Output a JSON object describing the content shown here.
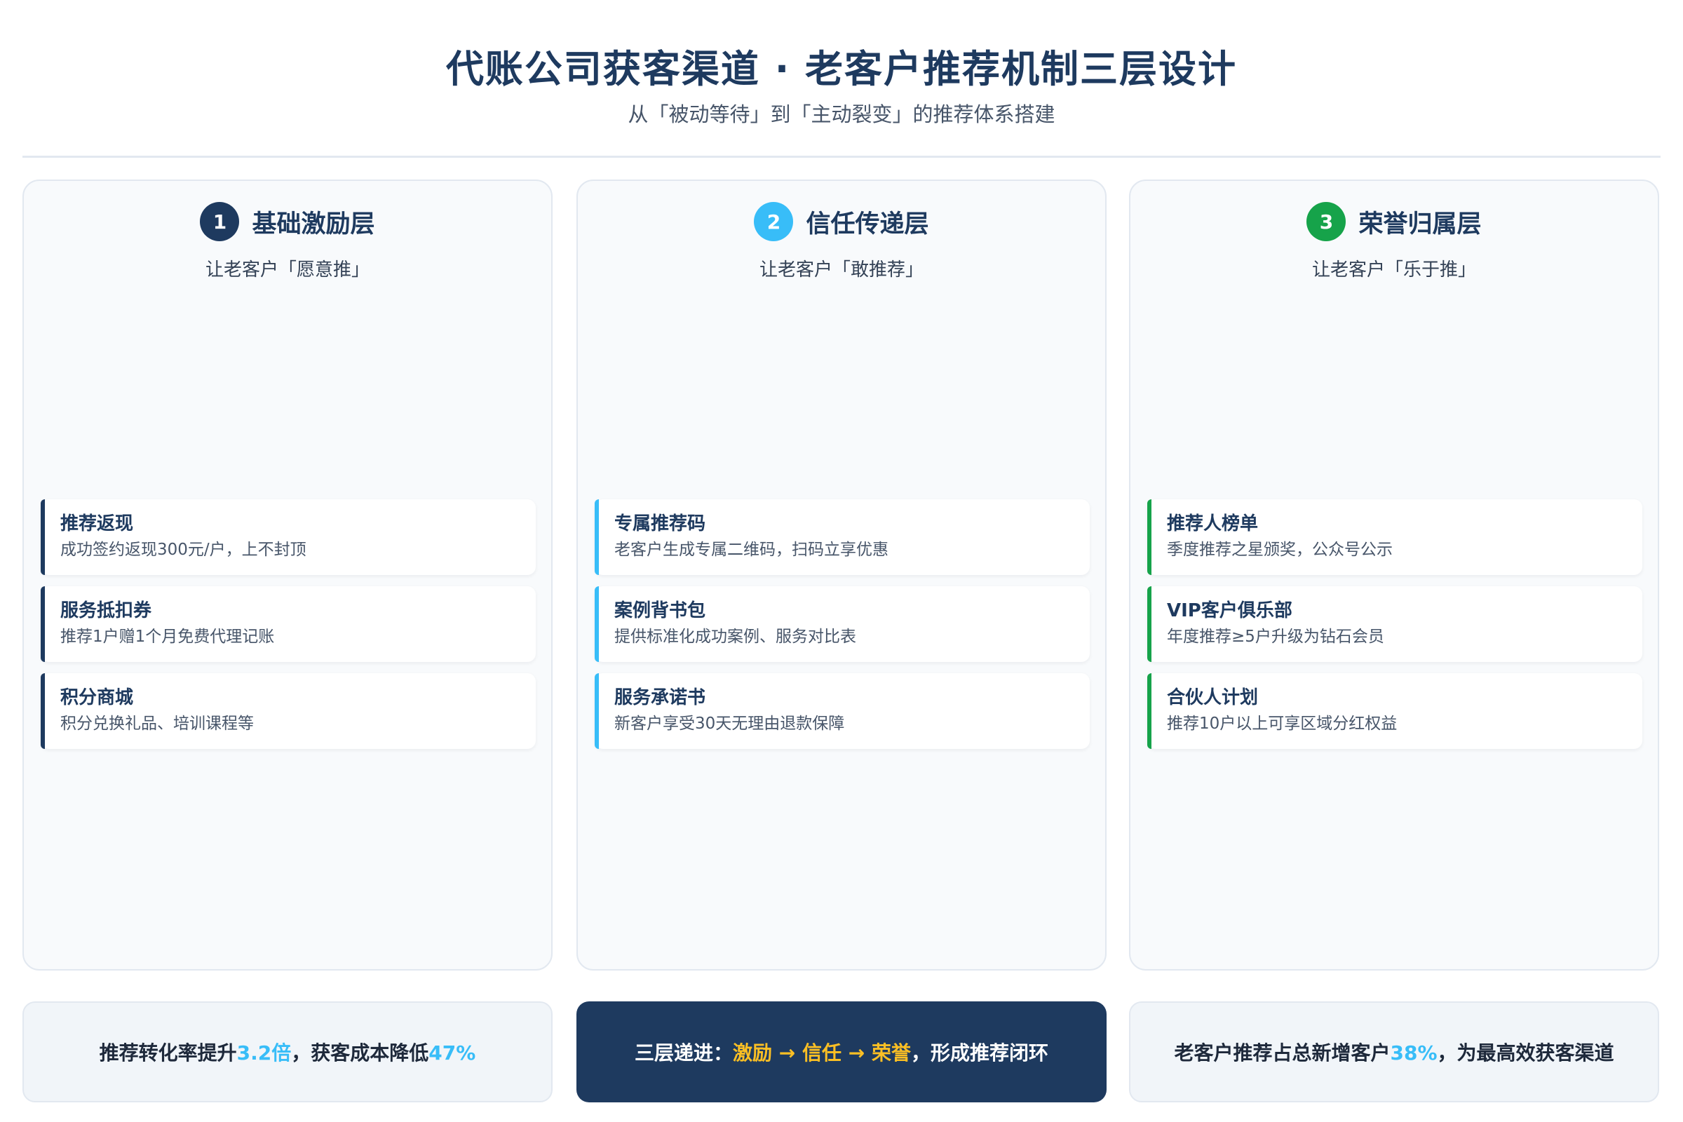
{
  "header": {
    "title": "代账公司获客渠道 · 老客户推荐机制三层设计",
    "subtitle": "从「被动等待」到「主动裂变」的推荐体系搭建"
  },
  "layers": [
    {
      "number": "1",
      "title": "基础激励层",
      "subtitle": "让老客户「愿意推」",
      "color": "#1e3a5f",
      "items": [
        {
          "title": "推荐返现",
          "desc": "成功签约返现300元/户，上不封顶"
        },
        {
          "title": "服务抵扣券",
          "desc": "推荐1户赠1个月免费代理记账"
        },
        {
          "title": "积分商城",
          "desc": "积分兑换礼品、培训课程等"
        }
      ]
    },
    {
      "number": "2",
      "title": "信任传递层",
      "subtitle": "让老客户「敢推荐」",
      "color": "#38bdf8",
      "items": [
        {
          "title": "专属推荐码",
          "desc": "老客户生成专属二维码，扫码立享优惠"
        },
        {
          "title": "案例背书包",
          "desc": "提供标准化成功案例、服务对比表"
        },
        {
          "title": "服务承诺书",
          "desc": "新客户享受30天无理由退款保障"
        }
      ]
    },
    {
      "number": "3",
      "title": "荣誉归属层",
      "subtitle": "让老客户「乐于推」",
      "color": "#16a34a",
      "items": [
        {
          "title": "推荐人榜单",
          "desc": "季度推荐之星颁奖，公众号公示"
        },
        {
          "title": "VIP客户俱乐部",
          "desc": "年度推荐≥5户升级为钻石会员"
        },
        {
          "title": "合伙人计划",
          "desc": "推荐10户以上可享区域分红权益"
        }
      ]
    }
  ],
  "footer": {
    "left": {
      "p1": "推荐转化率提升",
      "v1": "3.2倍",
      "p2": "，获客成本降低",
      "v2": "47%"
    },
    "center": {
      "p1": "三层递进：",
      "flow": "激励 → 信任 → 荣誉",
      "p2": "，形成推荐闭环"
    },
    "right": {
      "p1": "老客户推荐占总新增客户",
      "v1": "38%",
      "p2": "，为最高效获客渠道"
    }
  },
  "colors": {
    "navy": "#1e3a5f",
    "sky": "#38bdf8",
    "green": "#16a34a",
    "gold": "#fbbf24"
  }
}
